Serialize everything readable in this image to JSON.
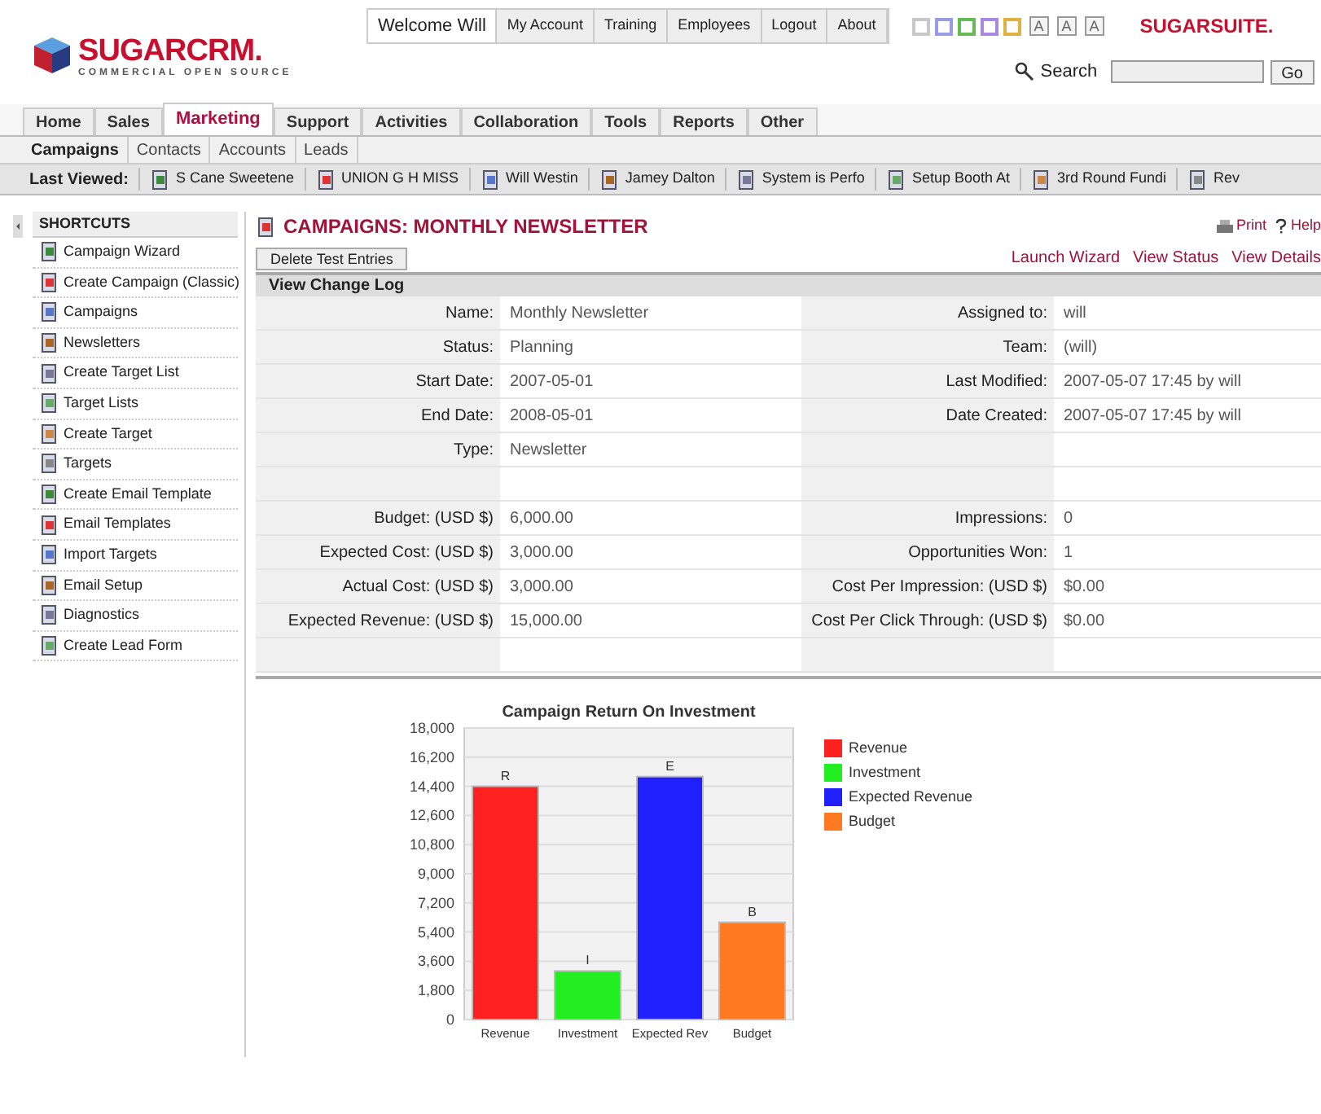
{
  "logo": {
    "name": "SUGARCRM.",
    "tagline": "COMMERCIAL OPEN SOURCE"
  },
  "top_links": [
    "Welcome Will",
    "My Account",
    "Training",
    "Employees",
    "Logout",
    "About"
  ],
  "theme_swatches": [
    {
      "color": "#c8c8c8"
    },
    {
      "color": "#9a9ae6"
    },
    {
      "color": "#66bb55"
    },
    {
      "color": "#aa88dd"
    },
    {
      "color": "#e0b040"
    }
  ],
  "font_sizes": [
    "A",
    "A",
    "A"
  ],
  "brand": "SUGARSUITE.",
  "search": {
    "label": "Search",
    "button": "Go"
  },
  "tabs": [
    {
      "label": "Home",
      "selected": false
    },
    {
      "label": "Sales",
      "selected": false
    },
    {
      "label": "Marketing",
      "selected": true
    },
    {
      "label": "Support",
      "selected": false
    },
    {
      "label": "Activities",
      "selected": false
    },
    {
      "label": "Collaboration",
      "selected": false
    },
    {
      "label": "Tools",
      "selected": false
    },
    {
      "label": "Reports",
      "selected": false
    },
    {
      "label": "Other",
      "selected": false
    }
  ],
  "subtabs": [
    {
      "label": "Campaigns",
      "selected": true
    },
    {
      "label": "Contacts",
      "selected": false
    },
    {
      "label": "Accounts",
      "selected": false
    },
    {
      "label": "Leads",
      "selected": false
    }
  ],
  "last_viewed": {
    "label": "Last Viewed:",
    "items": [
      "S Cane Sweetene",
      "UNION G H MISS",
      "Will Westin",
      "Jamey Dalton",
      "System is Perfo",
      "Setup Booth At",
      "3rd Round Fundi",
      "Rev"
    ]
  },
  "shortcuts": {
    "title": "SHORTCUTS",
    "items": [
      "Campaign Wizard",
      "Create Campaign (Classic)",
      "Campaigns",
      "Newsletters",
      "Create Target List",
      "Target Lists",
      "Create Target",
      "Targets",
      "Create Email Template",
      "Email Templates",
      "Import Targets",
      "Email Setup",
      "Diagnostics",
      "Create Lead Form"
    ]
  },
  "page_title": "CAMPAIGNS: MONTHLY NEWSLETTER",
  "page_actions": [
    "Print",
    "Help"
  ],
  "delete_button": "Delete Test Entries",
  "detail_links": [
    "Launch Wizard",
    "View Status",
    "View Details"
  ],
  "change_log": "View Change Log",
  "fields": [
    {
      "kind": "pair",
      "left": {
        "label": "Name:",
        "value": "Monthly Newsletter"
      },
      "right": {
        "label": "Assigned to:",
        "value": "will"
      }
    },
    {
      "kind": "pair",
      "left": {
        "label": "Status:",
        "value": "Planning"
      },
      "right": {
        "label": "Team:",
        "value": "(will)"
      }
    },
    {
      "kind": "pair",
      "left": {
        "label": "Start Date:",
        "value": "2007-05-01"
      },
      "right": {
        "label": "Last Modified:",
        "value": "2007-05-07 17:45 by will"
      }
    },
    {
      "kind": "pair",
      "left": {
        "label": "End Date:",
        "value": "2008-05-01"
      },
      "right": {
        "label": "Date Created:",
        "value": "2007-05-07 17:45 by will"
      }
    },
    {
      "kind": "pair",
      "left": {
        "label": "Type:",
        "value": "Newsletter"
      }
    },
    {
      "kind": "blank"
    },
    {
      "kind": "pair",
      "left": {
        "label": "Budget: (USD $)",
        "value": "6,000.00"
      },
      "right": {
        "label": "Impressions:",
        "value": "0"
      }
    },
    {
      "kind": "pair",
      "left": {
        "label": "Expected Cost: (USD $)",
        "value": "3,000.00"
      },
      "right": {
        "label": "Opportunities Won:",
        "value": "1"
      }
    },
    {
      "kind": "pair",
      "left": {
        "label": "Actual Cost: (USD $)",
        "value": "3,000.00"
      },
      "right": {
        "label": "Cost Per Impression: (USD $)",
        "value": "$0.00"
      }
    },
    {
      "kind": "pair",
      "left": {
        "label": "Expected Revenue: (USD $)",
        "value": "15,000.00"
      },
      "right": {
        "label": "Cost Per Click Through: (USD $)",
        "value": "$0.00"
      }
    },
    {
      "kind": "blank"
    }
  ],
  "chart": {
    "chart_data": {
      "type": "bar",
      "title": "Campaign Return On Investment",
      "categories": [
        "Revenue",
        "Investment",
        "Expected Rev",
        "Budget"
      ],
      "series": [
        {
          "name": "Revenue",
          "color": "#ff2020",
          "values": [
            14400,
            null,
            null,
            null
          ]
        },
        {
          "name": "Investment",
          "color": "#22ee22",
          "values": [
            null,
            3000,
            null,
            null
          ]
        },
        {
          "name": "Expected Revenue",
          "color": "#2020ff",
          "values": [
            null,
            null,
            15000,
            null
          ]
        },
        {
          "name": "Budget",
          "color": "#ff7a20",
          "values": [
            null,
            null,
            null,
            6000
          ]
        }
      ],
      "ylim": [
        0,
        18000
      ],
      "yticks": [
        {
          "value": 0,
          "label": "0"
        },
        {
          "value": 1800,
          "label": "1,800"
        },
        {
          "value": 3600,
          "label": "3,600"
        },
        {
          "value": 5400,
          "label": "5,400"
        },
        {
          "value": 7200,
          "label": "7,200"
        },
        {
          "value": 9000,
          "label": "9,000"
        },
        {
          "value": 10800,
          "label": "10,800"
        },
        {
          "value": 12600,
          "label": "12,600"
        },
        {
          "value": 14400,
          "label": "14,400"
        },
        {
          "value": 16200,
          "label": "16,200"
        },
        {
          "value": 18000,
          "label": "18,000"
        }
      ],
      "stacked": false,
      "grid": true,
      "legend": true,
      "value_labels": [
        "R",
        "I",
        "E",
        "B"
      ]
    }
  }
}
